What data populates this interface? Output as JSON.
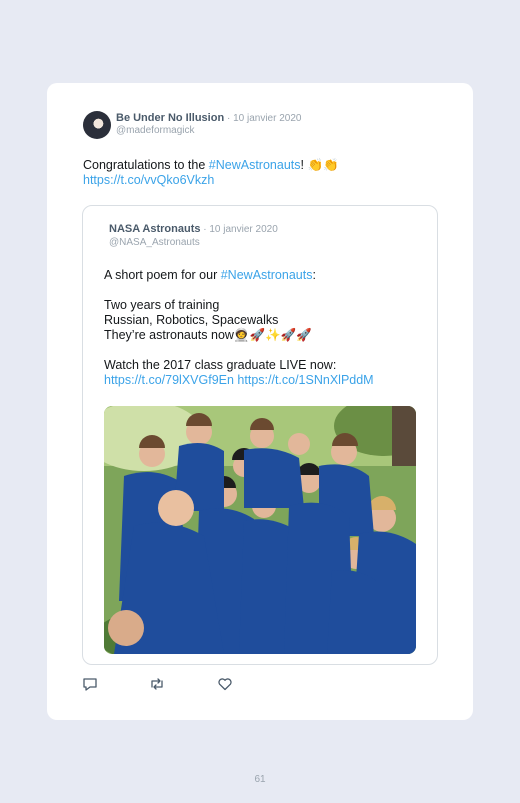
{
  "tweet": {
    "author_name": "Be Under No Illusion",
    "date": " · 10 janvier 2020",
    "handle": "@madeformagick",
    "text_before": "Congratulations to the ",
    "hashtag": "#NewAstronauts",
    "text_after": "! 👏👏",
    "link": "https://t.co/vvQko6Vkzh"
  },
  "quoted": {
    "author_name": "NASA Astronauts",
    "date": " · 10 janvier 2020",
    "handle": "@NASA_Astronauts",
    "line1_before": "A short poem for our ",
    "line1_hashtag": "#NewAstronauts",
    "line1_after": ":",
    "line2": "Two years of training",
    "line3": "Russian, Robotics, Spacewalks",
    "line4": "They’re astronauts now🧑‍🚀🚀✨🚀🚀",
    "line5": "Watch the 2017 class graduate LIVE now:",
    "link1": "https://t.co/79lXVGf9En",
    "link2": "https://t.co/1SNnXlPddM"
  },
  "icons": [
    "reply-icon",
    "retweet-icon",
    "like-icon"
  ],
  "page_number": "61"
}
